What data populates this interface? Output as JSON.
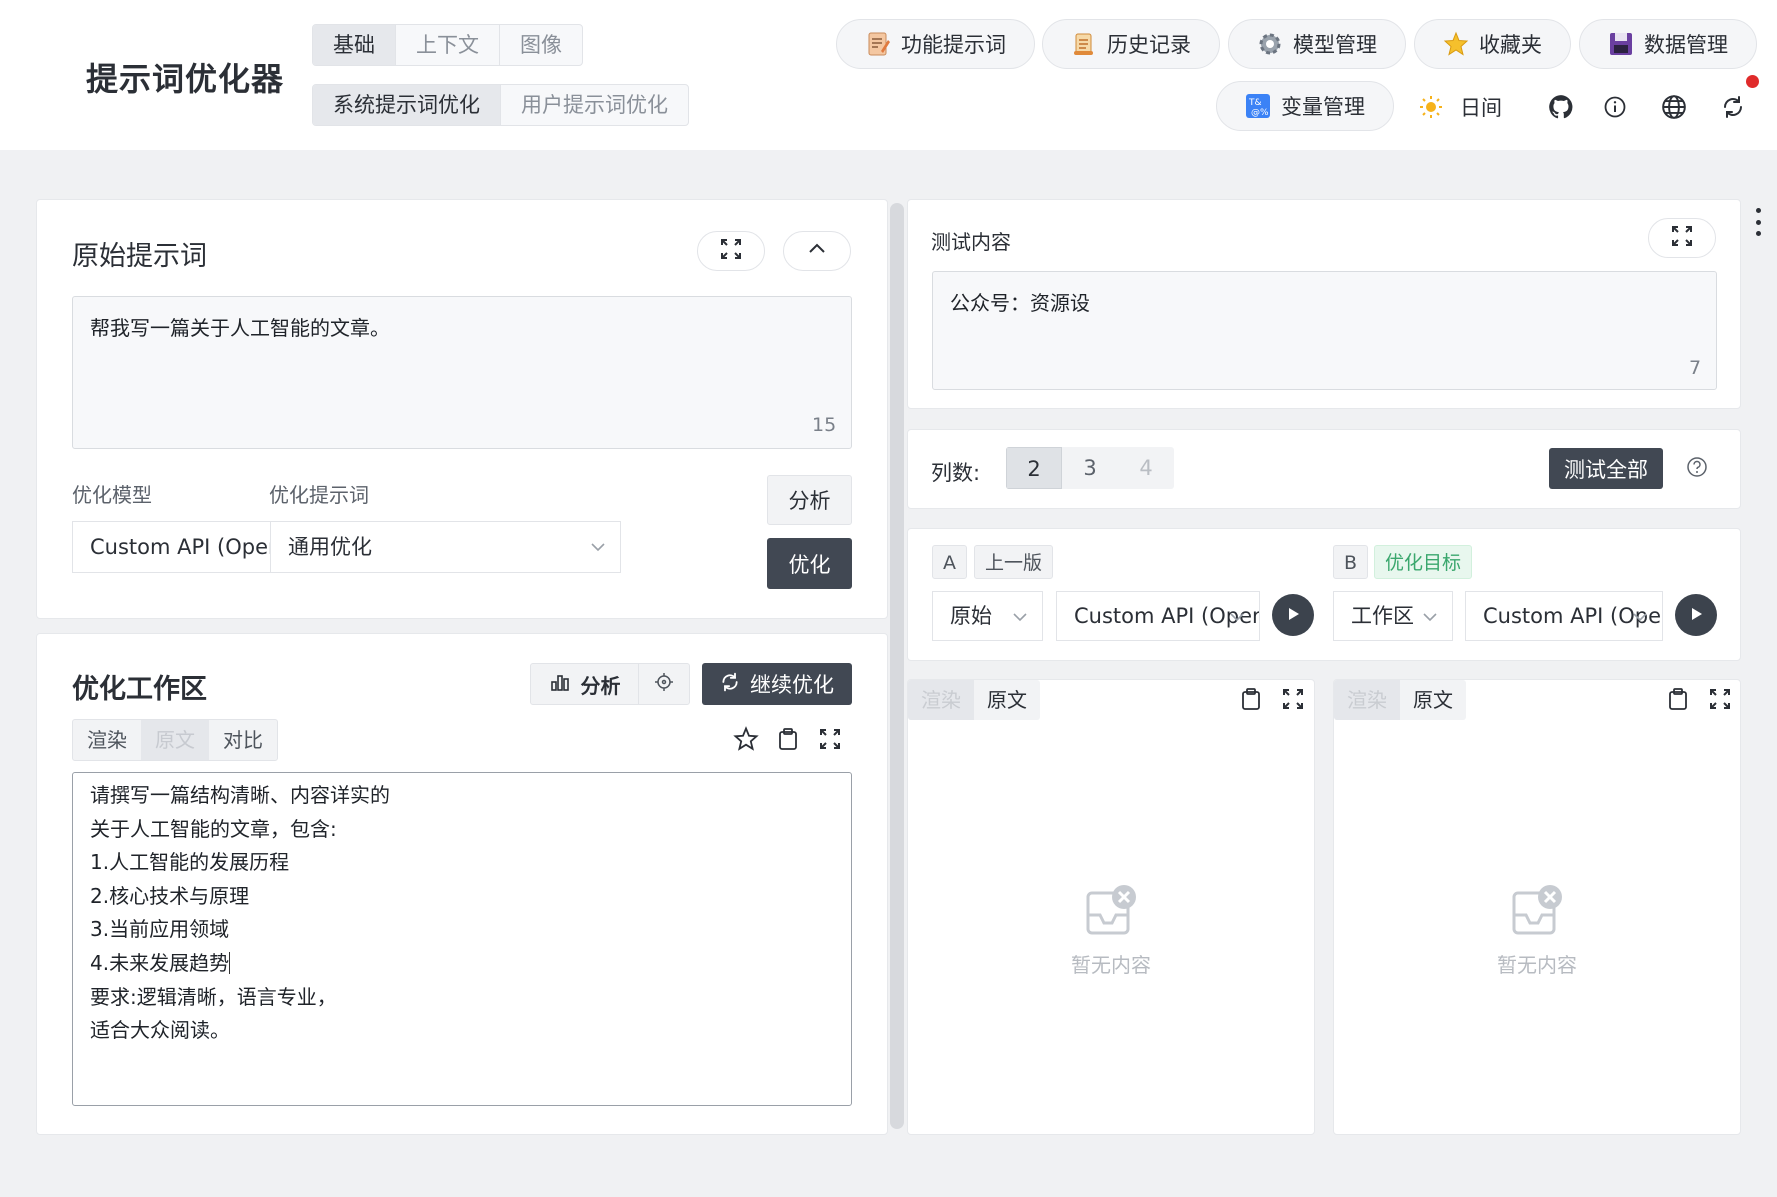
{
  "app": {
    "title": "提示词优化器"
  },
  "modes": {
    "items": [
      "基础",
      "上下文",
      "图像"
    ],
    "active": "基础"
  },
  "submodes": {
    "items": [
      "系统提示词优化",
      "用户提示词优化"
    ],
    "active": "系统提示词优化"
  },
  "header_buttons": {
    "function_prompts": "功能提示词",
    "history": "历史记录",
    "model_manage": "模型管理",
    "favorites": "收藏夹",
    "data_manage": "数据管理",
    "variable_manage": "变量管理",
    "theme": "日间"
  },
  "original": {
    "title": "原始提示词",
    "text": "帮我写一篇关于人工智能的文章。",
    "count": "15",
    "model_label": "优化模型",
    "prompt_label": "优化提示词",
    "model_value": "Custom API (OpenAI",
    "prompt_value": "通用优化",
    "analyze_button": "分析",
    "optimize_button": "优化"
  },
  "workspace": {
    "title": "优化工作区",
    "analyze_button": "分析",
    "continue_button": "继续优化",
    "tabs": [
      "渲染",
      "原文",
      "对比"
    ],
    "active_tab": "原文",
    "lines": [
      "请撰写一篇结构清晰、内容详实的",
      "关于人工智能的文章，包含:",
      "1.人工智能的发展历程",
      "2.核心技术与原理",
      "3.当前应用领域",
      "4.未来发展趋势",
      "要求:逻辑清晰，语言专业，",
      "适合大众阅读。"
    ]
  },
  "test": {
    "title": "测试内容",
    "text": "公众号：资源设",
    "count": "7"
  },
  "columns": {
    "label": "列数:",
    "options": [
      "2",
      "3",
      "4"
    ],
    "active": "2",
    "test_all_button": "测试全部"
  },
  "ab": {
    "a_label": "A",
    "a_tag": "上一版",
    "a_source": "原始",
    "a_model": "Custom API (OpenAI",
    "b_label": "B",
    "b_tag": "优化目标",
    "b_source": "工作区",
    "b_model": "Custom API (OpenAI"
  },
  "results": {
    "tabs": [
      "渲染",
      "原文"
    ],
    "active_tab": "渲染",
    "empty_text": "暂无内容"
  }
}
